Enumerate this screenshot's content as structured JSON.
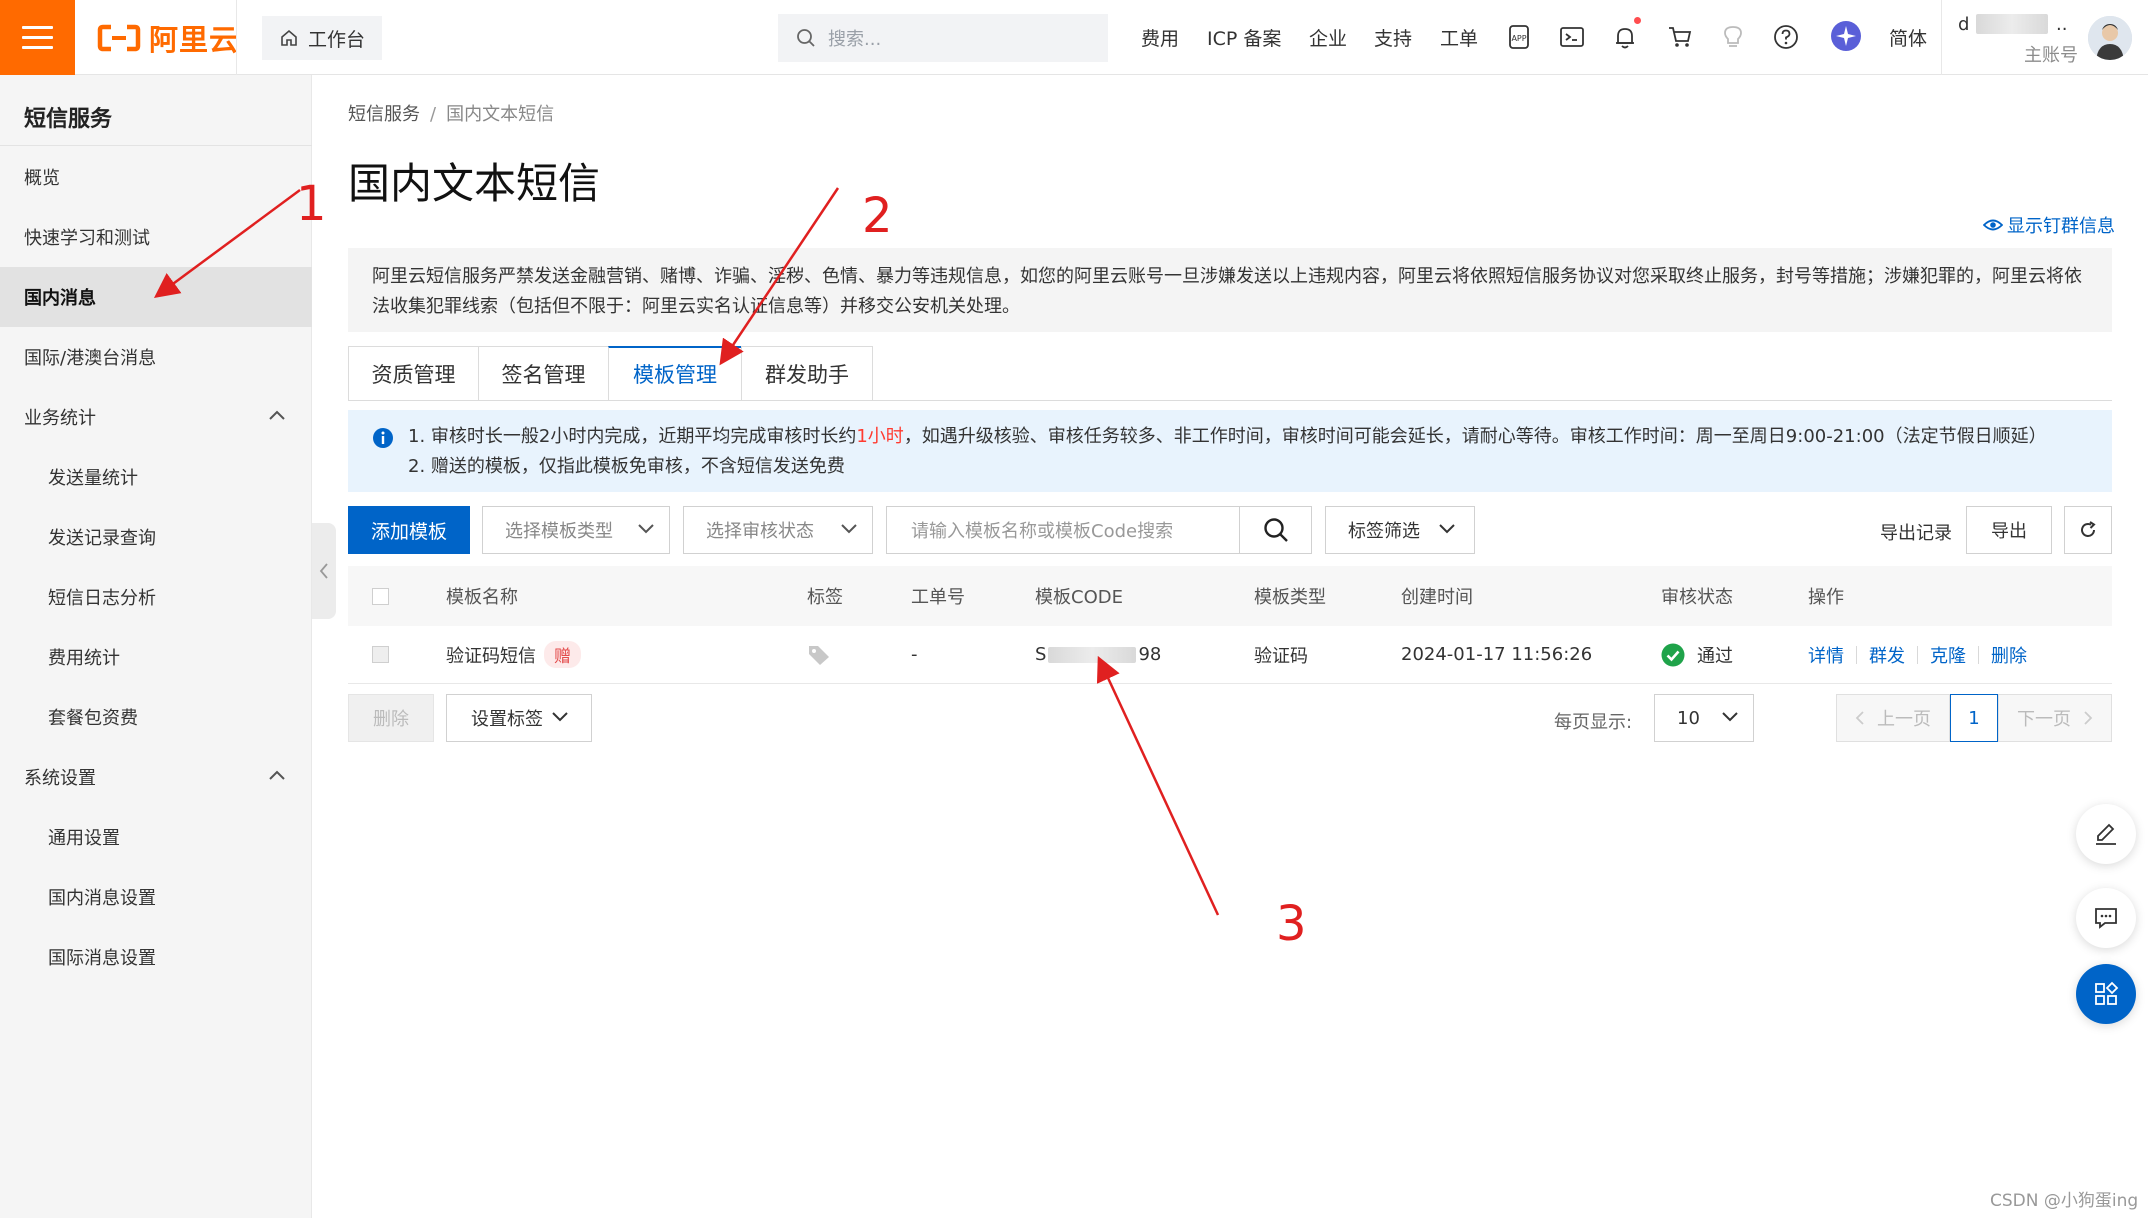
{
  "topbar": {
    "logo_text": "阿里云",
    "workbench": "工作台",
    "search_placeholder": "搜索...",
    "nav": [
      "费用",
      "ICP 备案",
      "企业",
      "支持",
      "工单"
    ],
    "lang": "简体",
    "user_name": "d",
    "user_name_suffix": "..",
    "user_role": "主账号"
  },
  "sidebar": {
    "title": "短信服务",
    "items": [
      {
        "label": "概览"
      },
      {
        "label": "快速学习和测试"
      },
      {
        "label": "国内消息"
      },
      {
        "label": "国际/港澳台消息"
      },
      {
        "label": "业务统计"
      },
      {
        "label": "发送量统计"
      },
      {
        "label": "发送记录查询"
      },
      {
        "label": "短信日志分析"
      },
      {
        "label": "费用统计"
      },
      {
        "label": "套餐包资费"
      },
      {
        "label": "系统设置"
      },
      {
        "label": "通用设置"
      },
      {
        "label": "国内消息设置"
      },
      {
        "label": "国际消息设置"
      }
    ]
  },
  "breadcrumb": {
    "root": "短信服务",
    "sep": "/",
    "current": "国内文本短信"
  },
  "page": {
    "title": "国内文本短信",
    "show_info": "显示钉群信息",
    "notice_line1": "阿里云短信服务严禁发送金融营销、赌博、诈骗、淫秽、色情、暴力等违规信息，如您的阿里云账号一旦涉嫌发送以上违规内容，阿里云将依照短信服务协议对您采取终止服务，封号等措施；涉嫌犯罪的，阿里云将依",
    "notice_line2": "法收集犯罪线索（包括但不限于：阿里云实名认证信息等）并移交公安机关处理。"
  },
  "tabs": [
    "资质管理",
    "签名管理",
    "模板管理",
    "群发助手"
  ],
  "info": {
    "line1_a": "1. 审核时长一般2小时内完成，近期平均完成审核时长约",
    "line1_hl": "1小时",
    "line1_b": "，如遇升级核验、审核任务较多、非工作时间，审核时间可能会延长，请耐心等待。审核工作时间：周一至周日9:00-21:00（法定节假日顺延）",
    "line2": "2. 赠送的模板，仅指此模板免审核，不含短信发送免费"
  },
  "toolbar": {
    "add_template": "添加模板",
    "select_type": "选择模板类型",
    "select_status": "选择审核状态",
    "search_placeholder": "请输入模板名称或模板Code搜索",
    "tag_filter": "标签筛选",
    "export_records": "导出记录",
    "export": "导出"
  },
  "table": {
    "headers": [
      "模板名称",
      "标签",
      "工单号",
      "模板CODE",
      "模板类型",
      "创建时间",
      "审核状态",
      "操作"
    ],
    "rows": [
      {
        "name": "验证码短信",
        "badge": "赠",
        "ticket": "-",
        "code_prefix": "S",
        "code_suffix": "98",
        "type": "验证码",
        "created": "2024-01-17 11:56:26",
        "status": "通过",
        "ops": [
          "详情",
          "群发",
          "克隆",
          "删除"
        ]
      }
    ]
  },
  "footer": {
    "delete": "删除",
    "set_tag": "设置标签",
    "per_page_label": "每页显示:",
    "per_page": "10",
    "prev": "上一页",
    "current_page": "1",
    "next": "下一页"
  },
  "annotations": [
    "1",
    "2",
    "3"
  ],
  "watermark": "CSDN @小狗蛋ing",
  "colors": {
    "brand": "#ff6a00",
    "primary": "#0064c8",
    "annotation": "#e02020",
    "success": "#1fa34a"
  }
}
